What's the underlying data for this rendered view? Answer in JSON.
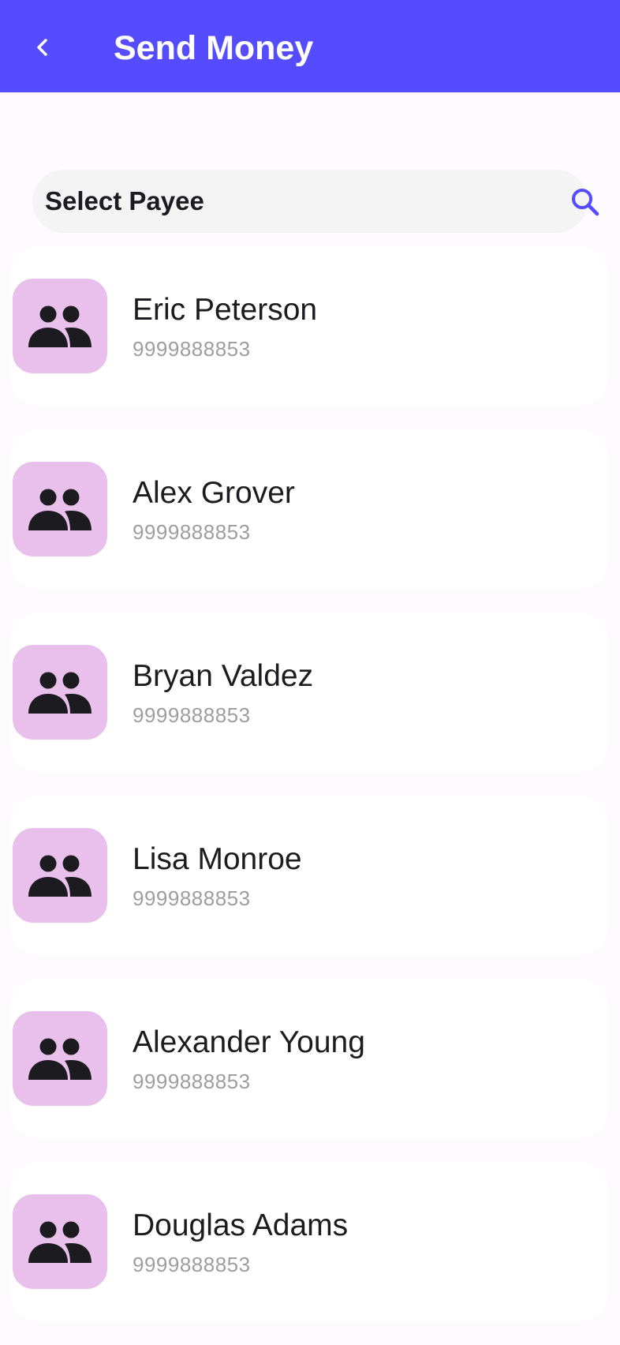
{
  "header": {
    "title": "Send Money",
    "back_icon": "chevron-left-icon",
    "background": "#554cff"
  },
  "search": {
    "placeholder": "Select Payee",
    "value": "",
    "icon": "search-icon",
    "icon_color": "#554cff"
  },
  "payees": [
    {
      "name": "Eric Peterson",
      "phone": "9999888853"
    },
    {
      "name": "Alex Grover",
      "phone": "9999888853"
    },
    {
      "name": "Bryan Valdez",
      "phone": "9999888853"
    },
    {
      "name": "Lisa Monroe",
      "phone": "9999888853"
    },
    {
      "name": "Alexander Young",
      "phone": "9999888853"
    },
    {
      "name": "Douglas Adams",
      "phone": "9999888853"
    }
  ],
  "avatar": {
    "icon": "group-icon",
    "background": "#e9c0ec"
  }
}
